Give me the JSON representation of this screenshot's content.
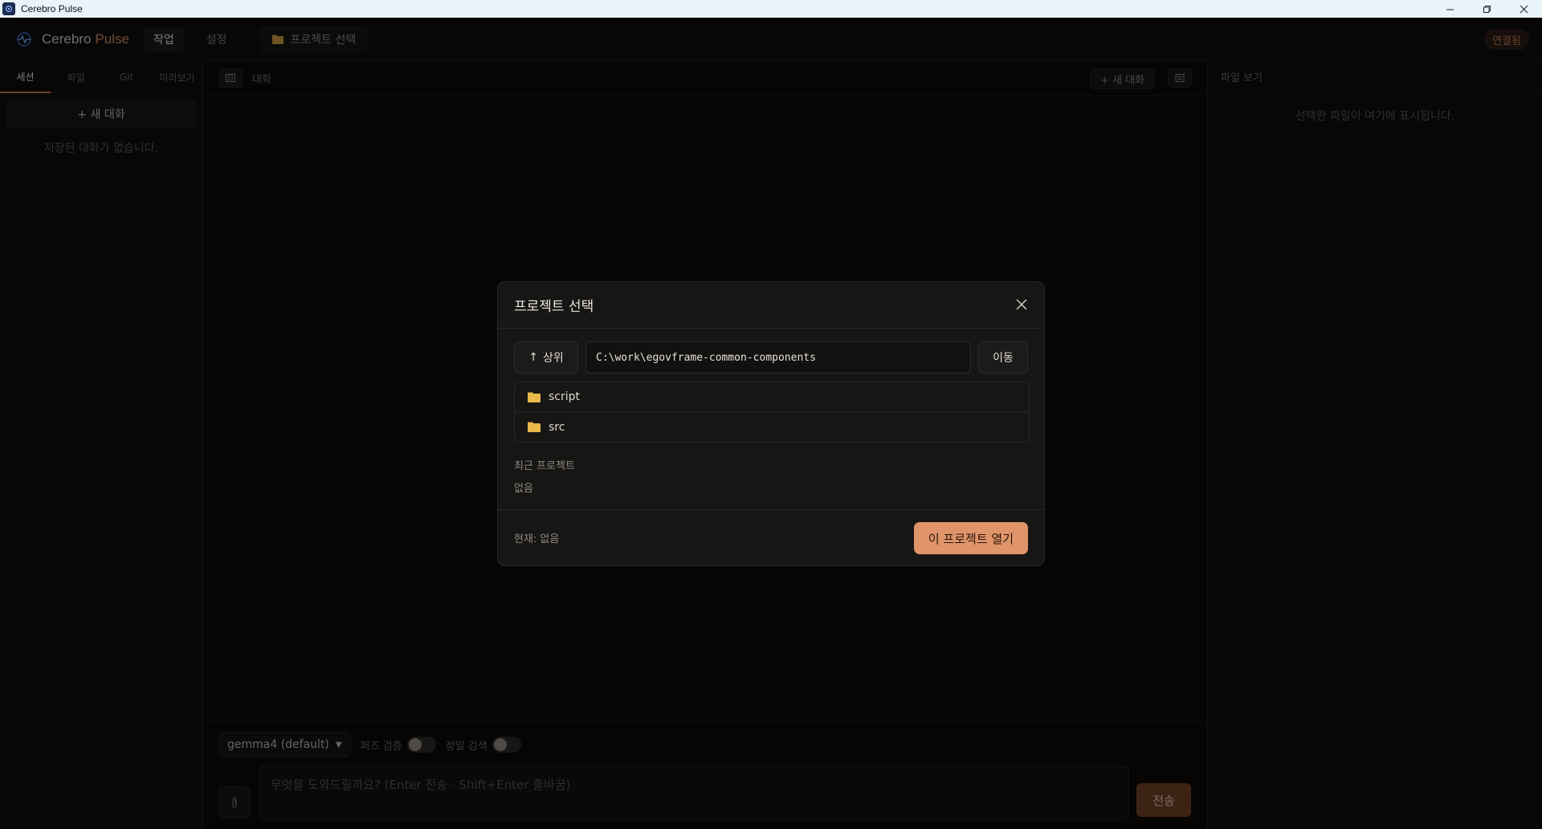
{
  "window": {
    "title": "Cerebro Pulse"
  },
  "header": {
    "brand_primary": "Cerebro",
    "brand_accent": "Pulse",
    "nav": [
      {
        "label": "작업",
        "active": true
      },
      {
        "label": "설정",
        "active": false
      }
    ],
    "project_button": "프로젝트 선택",
    "connection_status": "연결됨"
  },
  "sidebar": {
    "tabs": [
      {
        "label": "세션",
        "active": true
      },
      {
        "label": "파일",
        "active": false
      },
      {
        "label": "Git",
        "active": false
      },
      {
        "label": "미리보기",
        "active": false
      }
    ],
    "new_chat": "+ 새 대화",
    "empty_text": "저장된 대화가 없습니다."
  },
  "center": {
    "title": "대화",
    "new_chat": "+ 새 대화",
    "composer": {
      "model": "gemma4 (default)",
      "toggles": [
        {
          "label": "퍼즈 검증",
          "on": false
        },
        {
          "label": "정밀 검색",
          "on": false
        }
      ],
      "placeholder": "무엇을 도와드릴까요? (Enter 전송 · Shift+Enter 줄바꿈)",
      "send": "전송"
    }
  },
  "right_panel": {
    "title": "파일 보기",
    "empty_text": "선택한 파일이 여기에 표시됩니다."
  },
  "modal": {
    "title": "프로젝트 선택",
    "up_button": "상위",
    "path": "C:\\work\\egovframe-common-components",
    "go_button": "이동",
    "folders": [
      "script",
      "src"
    ],
    "recent_label": "최근 프로젝트",
    "recent_empty": "없음",
    "current": "현재: 없음",
    "open_button": "이 프로젝트 열기"
  },
  "colors": {
    "accent": "#e0946a",
    "brand_accent": "#d08a5e",
    "folder": "#e8b84a"
  }
}
